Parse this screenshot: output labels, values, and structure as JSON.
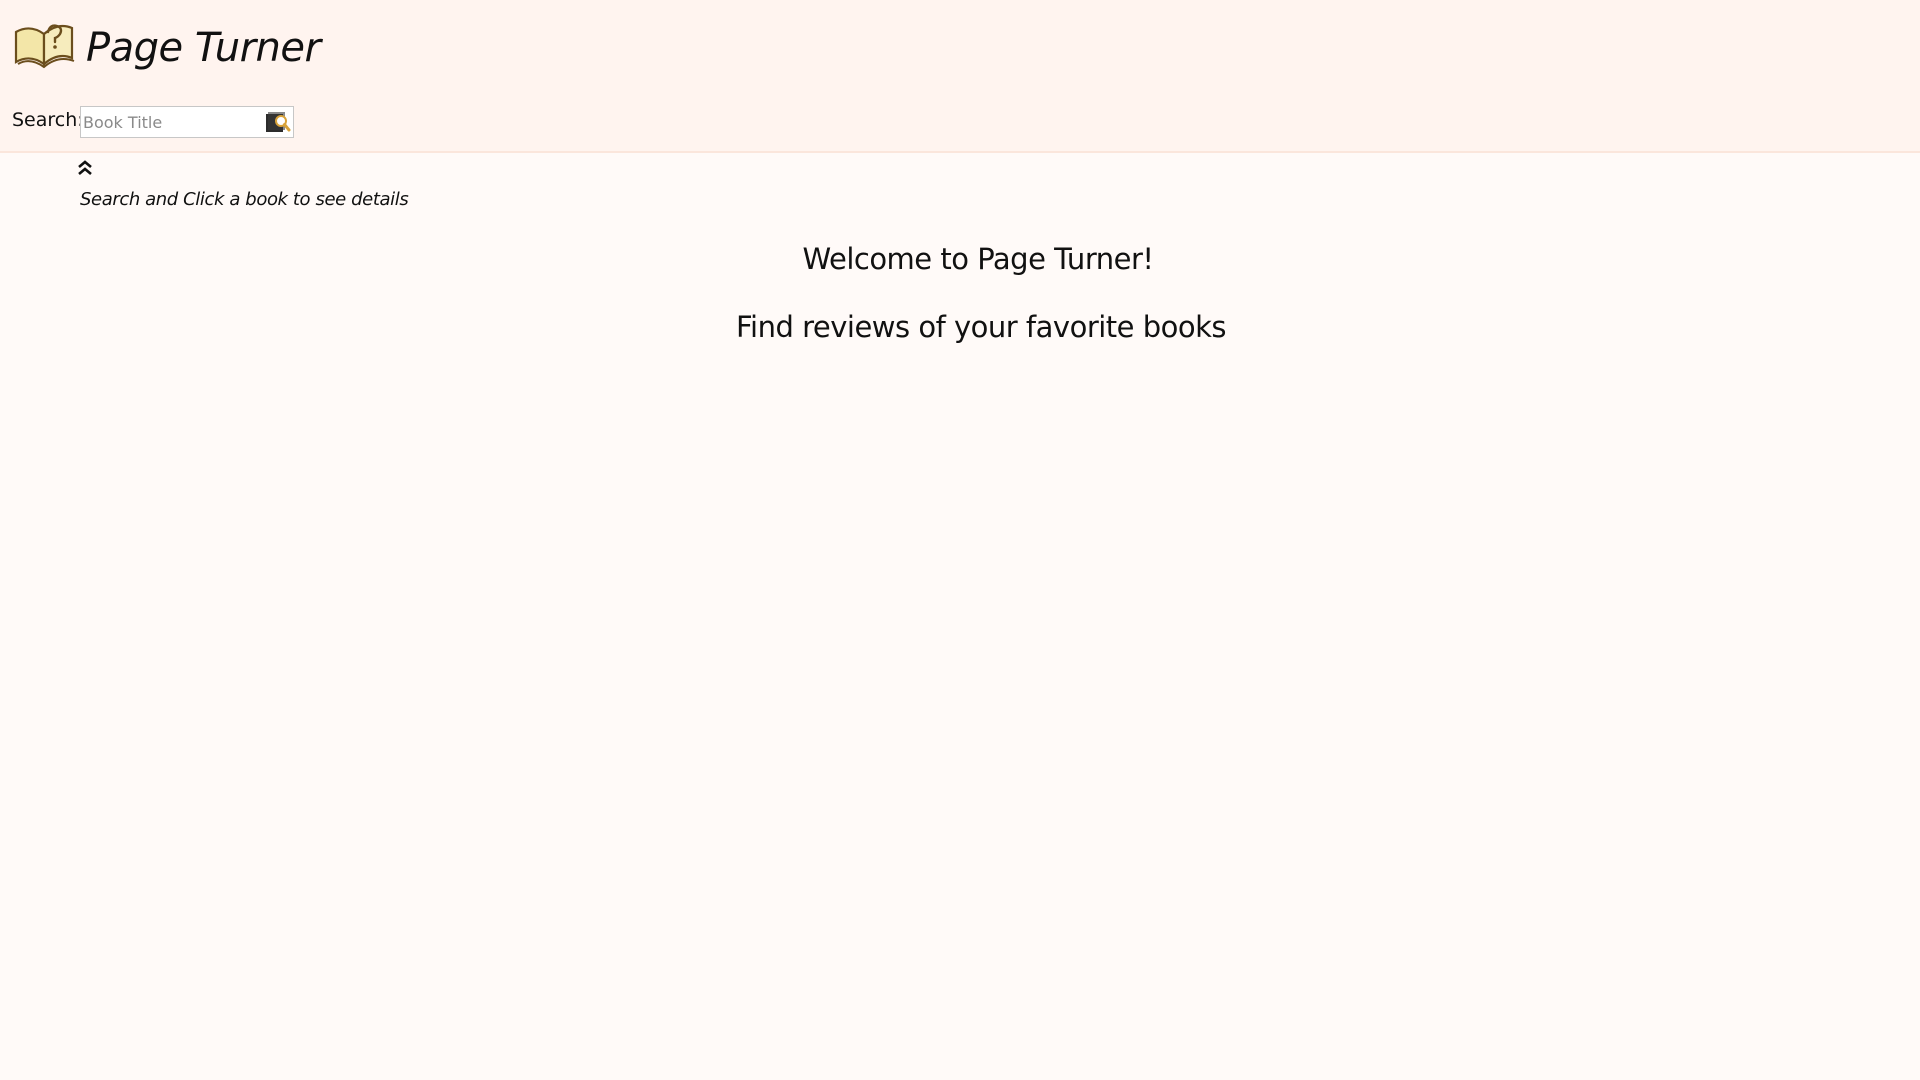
{
  "header": {
    "logo_icon": "open-book-question-icon",
    "title": "Page Turner"
  },
  "search": {
    "label": "Search:",
    "placeholder": "Book Title",
    "value": "",
    "button_icon": "search-book-icon"
  },
  "hint": {
    "icon": "double-chevron-up-icon",
    "text": "Search and Click a book to see details"
  },
  "main": {
    "welcome": "Welcome to Page Turner!",
    "tagline": "Find reviews of your favorite books"
  },
  "colors": {
    "header_background": "#fff4ef",
    "page_background": "#fffaf8",
    "logo_fill": "#f3e6a8",
    "logo_stroke": "#6b4e1d"
  }
}
